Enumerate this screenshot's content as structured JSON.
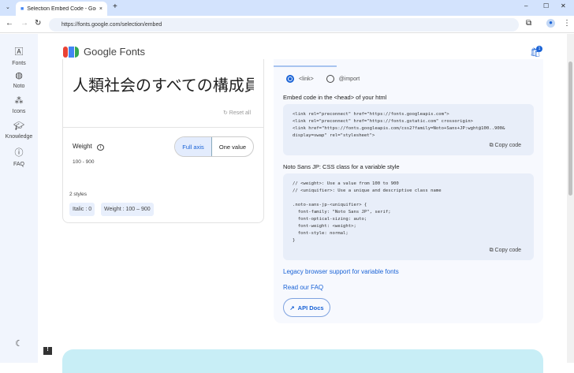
{
  "browser": {
    "tab_title": "Selection Embed Code - Google Fonts",
    "url": "https://fonts.google.com/selection/embed"
  },
  "sidebar": {
    "items": [
      {
        "label": "Fonts",
        "icon": "font-icon"
      },
      {
        "label": "Noto",
        "icon": "globe-icon"
      },
      {
        "label": "Icons",
        "icon": "shapes-icon"
      },
      {
        "label": "Knowledge",
        "icon": "school-icon"
      },
      {
        "label": "FAQ",
        "icon": "help-icon"
      }
    ]
  },
  "header": {
    "title": "Google Fonts",
    "bag_count": "1"
  },
  "preview": {
    "sample_text": "人類社会のすべての構成員",
    "reset_label": "Reset all",
    "weight_label": "Weight",
    "weight_range": "100 - 900",
    "full_axis": "Full axis",
    "one_value": "One value",
    "styles_count": "2 styles",
    "chip_italic": "Italic : 0",
    "chip_weight": "Weight : 100 – 900"
  },
  "embed": {
    "option_link": "<link>",
    "option_import": "@import",
    "selected": "<link>",
    "embed_label": "Embed code in the <head> of your html",
    "embed_code": "<link rel=\"preconnect\" href=\"https://fonts.googleapis.com\">\n<link rel=\"preconnect\" href=\"https://fonts.gstatic.com\" crossorigin>\n<link href=\"https://fonts.googleapis.com/css2?family=Noto+Sans+JP:wght@100..900&\ndisplay=swap\" rel=\"stylesheet\">",
    "copy_label": "Copy code",
    "css_label": "Noto Sans JP: CSS class for a variable style",
    "css_code": "// <weight>: Use a value from 100 to 900\n// <uniquifier>: Use a unique and descriptive class name\n\n.noto-sans-jp-<uniquifier> {\n  font-family: \"Noto Sans JP\", serif;\n  font-optical-sizing: auto;\n  font-weight: <weight>;\n  font-style: normal;\n}",
    "legacy_link": "Legacy browser support for variable fonts",
    "faq_link": "Read our FAQ",
    "api_docs": "API Docs"
  }
}
